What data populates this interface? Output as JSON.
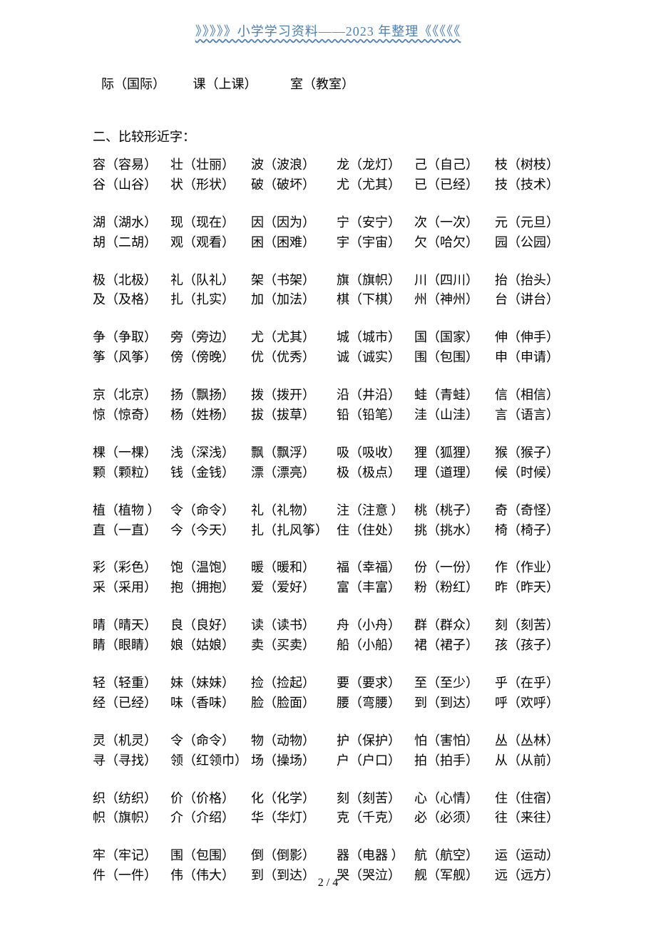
{
  "header": "》》》》》小学学习资料——2023 年整理《《《《《",
  "line1_items": [
    "际（国际）",
    "课（上课）",
    "室（教室）"
  ],
  "section_title": "二、比较形近字：",
  "groups": [
    [
      [
        "容（容易）",
        "壮（壮丽）",
        "波（波浪）",
        "龙（龙灯）",
        "己（自己）",
        "枝（树枝）"
      ],
      [
        "谷（山谷）",
        "状（形状）",
        "破（破坏）",
        "尤（尤其）",
        "已（已经）",
        "技（技术）"
      ]
    ],
    [
      [
        "湖（湖水）",
        "现（现在）",
        "因（因为）",
        "宁（安宁）",
        "次（一次）",
        "元（元旦）"
      ],
      [
        "胡（二胡）",
        "观（观看）",
        "困（困难）",
        "宇（宇宙）",
        "欠（哈欠）",
        "园（公园）"
      ]
    ],
    [
      [
        "极（北极）",
        "礼（队礼）",
        "架（书架）",
        "旗（旗帜）",
        "川（四川）",
        "抬（抬头）"
      ],
      [
        "及（及格）",
        "扎（扎实）",
        "加（加法）",
        "棋（下棋）",
        "州（神州）",
        "台（讲台）"
      ]
    ],
    [
      [
        "争（争取）",
        "旁（旁边）",
        "尤（尤其）",
        "城（城市）",
        "国（国家）",
        "伸（伸手）"
      ],
      [
        "筝（风筝）",
        "傍（傍晚）",
        "优（优秀）",
        "诚（诚实）",
        "围（包围）",
        "申（申请）"
      ]
    ],
    [
      [
        "京（北京）",
        "扬（飘扬）",
        "拨（拨开）",
        "沿（井沿）",
        "蛙（青蛙）",
        "信（相信）"
      ],
      [
        "惊（惊奇）",
        "杨（姓杨）",
        "拔（拔草）",
        "铅（铅笔）",
        "洼（山洼）",
        "言（语言）"
      ]
    ],
    [
      [
        "棵（一棵）",
        "浅（深浅）",
        "飘（飘浮）",
        "吸（吸收）",
        "狸（狐狸）",
        "猴（猴子）"
      ],
      [
        "颗（颗粒）",
        "钱（金钱）",
        "漂（漂亮）",
        "极（极点）",
        "理（道理）",
        "候（时候）"
      ]
    ],
    [
      [
        "植（植物 ）",
        "令（命令）",
        "礼（礼物）",
        "注（注意 ）",
        "桃（桃子）",
        "奇（奇怪）"
      ],
      [
        "直（一直）",
        "今（今天）",
        "扎（扎风筝）",
        "住（住处）",
        "挑（挑水）",
        "椅（椅子）"
      ]
    ],
    [
      [
        "彩（彩色）",
        "饱（温饱）",
        "暖（暖和）",
        "福（幸福）",
        "份（一份）",
        "作（作业）"
      ],
      [
        "采（采用）",
        "抱（拥抱）",
        "爱（爱好）",
        "富（丰富）",
        "粉（粉红）",
        "昨（昨天）"
      ]
    ],
    [
      [
        "晴（晴天）",
        "良（良好）",
        "读（读书）",
        "舟（小舟）",
        "群（群众）",
        "刻（刻苦）"
      ],
      [
        "睛（眼睛）",
        "娘（姑娘）",
        "卖（买卖）",
        "船（小船）",
        "裙（裙子）",
        "孩（孩子）"
      ]
    ],
    [
      [
        "轻（轻重）",
        "妹（妹妹）",
        "捡（捡起）",
        "要（要求）",
        "至（至少）",
        "乎（在乎）"
      ],
      [
        "经（已经）",
        "味（香味）",
        "脸（脸面）",
        "腰（弯腰）",
        "到（到达）",
        "呼（欢呼）"
      ]
    ],
    [
      [
        "灵（机灵）",
        "令（命令）",
        "物（动物）",
        "护（保护）",
        "怕（害怕）",
        "丛（丛林）"
      ],
      [
        "寻（寻找）",
        "领（红领巾）",
        "场（操场）",
        "户（户口）",
        "拍（拍手）",
        "从（从前）"
      ]
    ],
    [
      [
        "织（纺织）",
        "价（价格）",
        "化（化学）",
        "刻（刻苦）",
        "心（心情）",
        "住（住宿）"
      ],
      [
        "帜（旗帜）",
        "介（介绍）",
        "华（华灯）",
        "克（千克）",
        "必（必须）",
        "往（来往）"
      ]
    ],
    [
      [
        "牢（牢记）",
        "围（包围）",
        "倒（倒影）",
        "器（电器 ）",
        "航（航空）",
        "运（运动）"
      ],
      [
        "件（一件）",
        "伟（伟大）",
        "到（到达）",
        "哭（哭泣）",
        "舰（军舰）",
        "远（远方）"
      ]
    ]
  ],
  "footer": "2 / 4"
}
